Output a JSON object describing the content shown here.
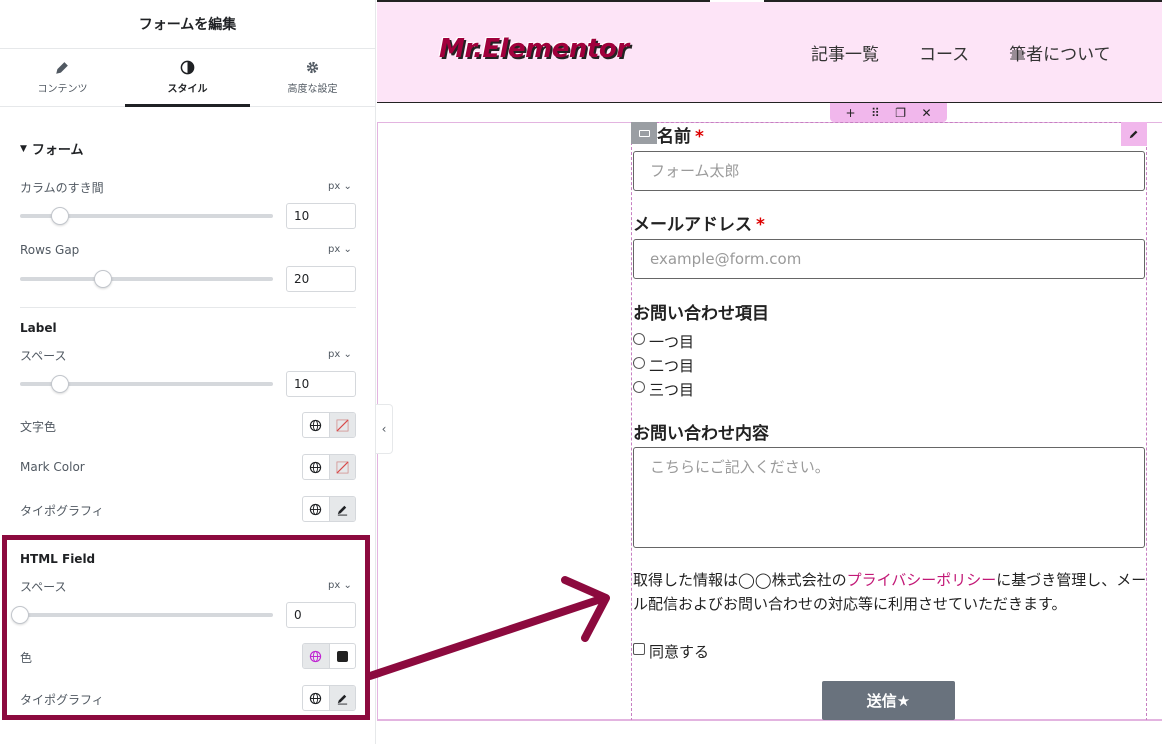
{
  "panel": {
    "title": "フォームを編集",
    "tabs": [
      {
        "label": "コンテンツ",
        "icon": "pencil-icon"
      },
      {
        "label": "スタイル",
        "icon": "contrast-icon"
      },
      {
        "label": "高度な設定",
        "icon": "gear-icon"
      }
    ],
    "active_tab": "スタイル",
    "form_section": {
      "title": "フォーム",
      "column_gap": {
        "label": "カラムのすき間",
        "unit": "px",
        "value": "10",
        "slider_percent": 16
      },
      "rows_gap": {
        "label": "Rows Gap",
        "unit": "px",
        "value": "20",
        "slider_percent": 33
      }
    },
    "label_section": {
      "title": "Label",
      "space": {
        "label": "スペース",
        "unit": "px",
        "value": "10",
        "slider_percent": 16
      },
      "text_color": {
        "label": "文字色"
      },
      "mark_color": {
        "label": "Mark Color"
      },
      "typography": {
        "label": "タイポグラフィ"
      }
    },
    "html_field_section": {
      "title": "HTML Field",
      "space": {
        "label": "スペース",
        "unit": "px",
        "value": "0",
        "slider_percent": 0
      },
      "color": {
        "label": "色",
        "swatch": "#222222"
      },
      "typography": {
        "label": "タイポグラフィ"
      }
    }
  },
  "site": {
    "logo": "Mr.Elementor",
    "nav": [
      "記事一覧",
      "コース",
      "筆者について"
    ]
  },
  "form": {
    "name": {
      "label": "名前",
      "required_mark": "*",
      "placeholder": "フォーム太郎"
    },
    "email": {
      "label": "メールアドレス",
      "required_mark": "*",
      "placeholder": "example@form.com"
    },
    "inquiry_type": {
      "label": "お問い合わせ項目",
      "options": [
        "一つ目",
        "二つ目",
        "三つ目"
      ]
    },
    "message": {
      "label": "お問い合わせ内容",
      "placeholder": "こちらにご記入ください。"
    },
    "html_field": {
      "before": "取得した情報は◯◯株式会社の",
      "link": "プライバシーポリシー",
      "after": "に基づき管理し、メール配信およびお問い合わせの対応等に利用させていただきます。"
    },
    "agree": {
      "label": "同意する"
    },
    "submit": {
      "label": "送信★"
    }
  },
  "colors": {
    "accent": "#8c0a3e",
    "header_bg": "#fde4f7",
    "link": "#c21876",
    "button_bg": "#69727d",
    "selection": "#f1b7ec"
  }
}
